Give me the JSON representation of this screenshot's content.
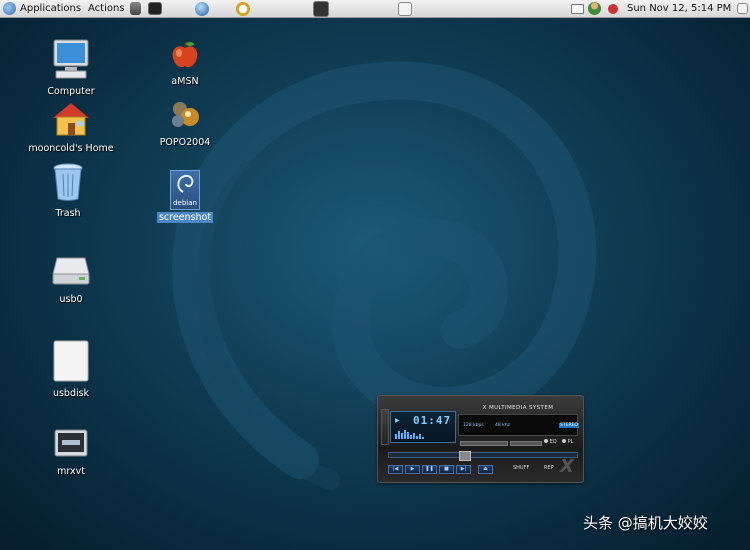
{
  "panel": {
    "applications_label": "Applications",
    "actions_label": "Actions",
    "clock": "Sun Nov 12,  5:14 PM"
  },
  "desktop": {
    "icons": [
      {
        "label": "Computer",
        "icon": "computer-icon"
      },
      {
        "label": "mooncold's Home",
        "icon": "home-folder-icon"
      },
      {
        "label": "Trash",
        "icon": "trash-icon"
      },
      {
        "label": "usb0",
        "icon": "drive-icon"
      },
      {
        "label": "usbdisk",
        "icon": "disk-icon"
      },
      {
        "label": "mrxvt",
        "icon": "terminal-icon"
      },
      {
        "label": "aMSN",
        "icon": "apple-icon"
      },
      {
        "label": "POPO2004",
        "icon": "popo-icon"
      },
      {
        "label": "screenshot",
        "icon": "debian-image-icon",
        "thumbnail_text": "debian",
        "selected": true
      }
    ]
  },
  "player": {
    "title": "X MULTIMEDIA SYSTEM",
    "time": "01:47",
    "bitrate": "128 kbps",
    "samplerate": "48 khz",
    "stereo": "STEREO",
    "eq_label": "EQ",
    "pl_label": "PL",
    "shuffle_label": "SHUFF",
    "repeat_label": "REP",
    "logo": "X"
  },
  "watermark": "头条 @搞机大姣姣",
  "colors": {
    "desktop_bg": "#0f3b52",
    "panel_bg": "#e4e4e4",
    "selection": "#4d86c2",
    "lcd_text": "#7fd0ff"
  }
}
